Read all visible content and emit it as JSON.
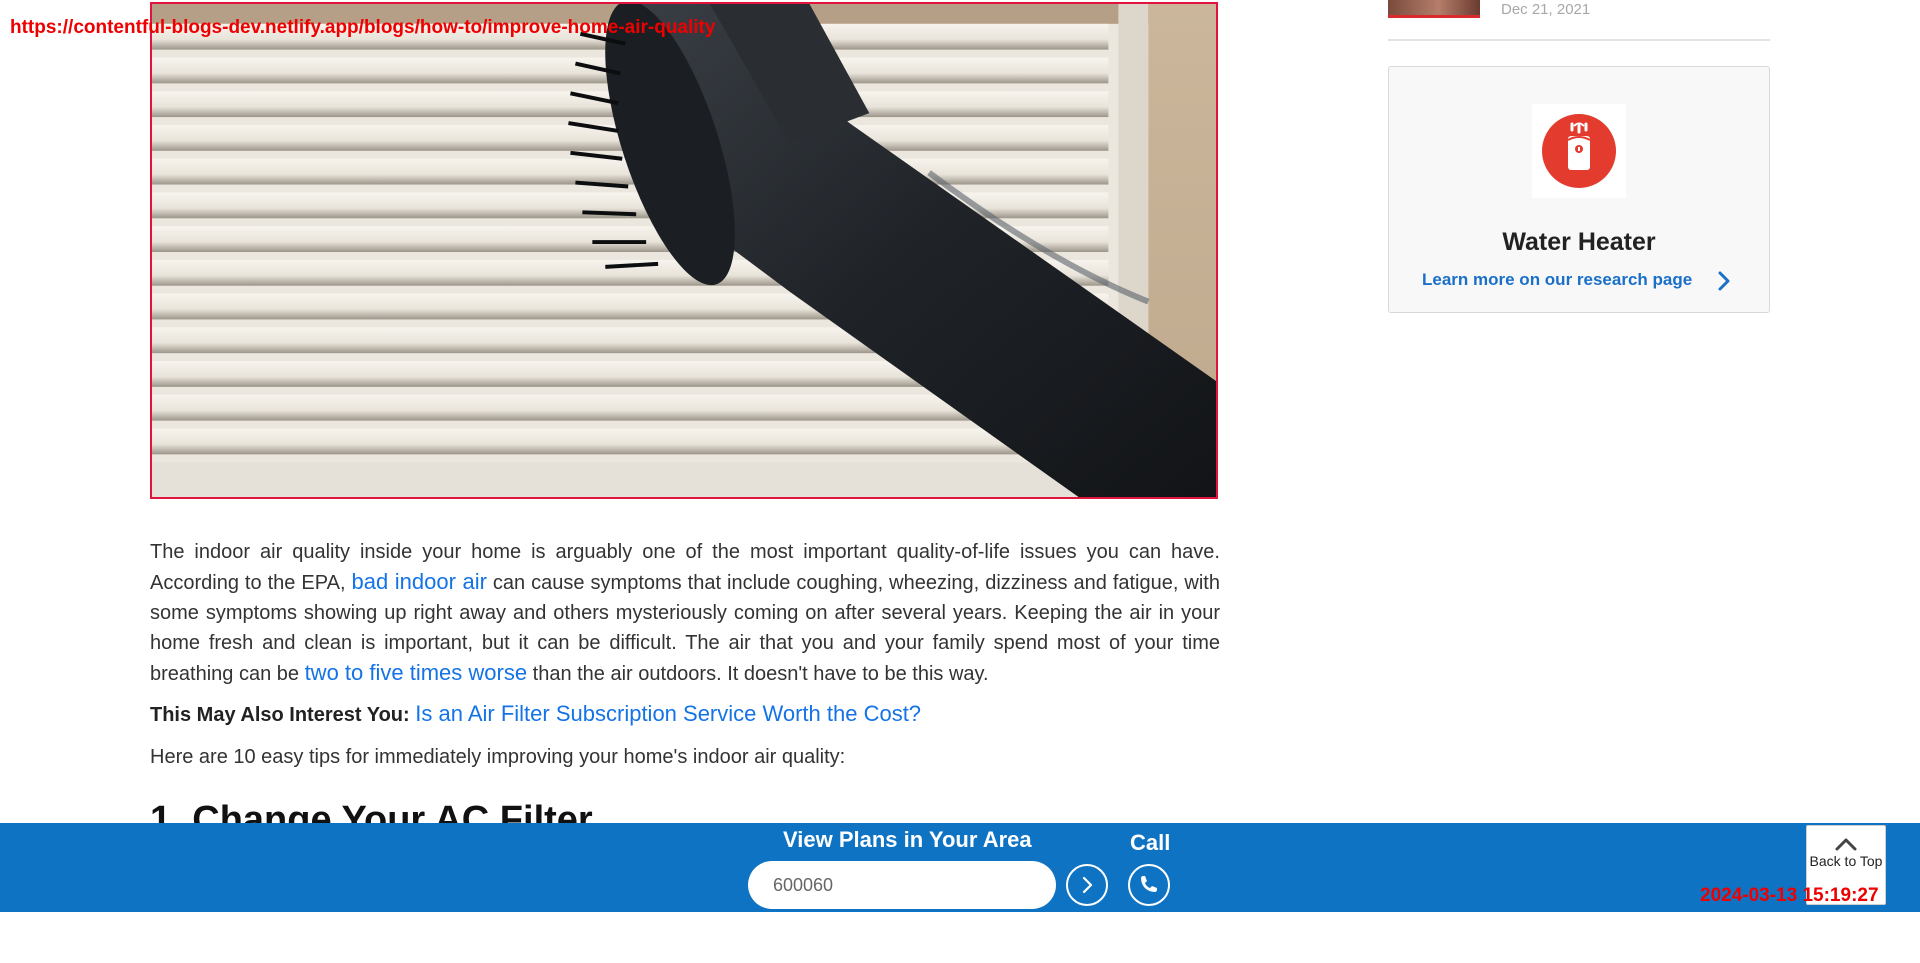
{
  "overlay": {
    "url": "https://contentful-blogs-dev.netlify.app/blogs/how-to/improve-home-air-quality",
    "timestamp": "2024-03-13 15:19:27"
  },
  "article": {
    "para1_a": "The indoor air quality inside your home is arguably one of the most important quality-of-life issues you can have. According to the EPA, ",
    "link1": "bad indoor air",
    "para1_b": " can cause symptoms that include coughing, wheezing, dizziness and fatigue, with some symptoms showing up right away and others mysteriously coming on after several years. Keeping the air in your home fresh and clean is important, but it can be difficult. The air that you and your family spend most of your time breathing can be ",
    "link2": "two to five times worse",
    "para1_c": " than the air outdoors. It doesn't have to be this way.",
    "interest_label": "This May Also Interest You:",
    "interest_link": "Is an Air Filter Subscription Service Worth the Cost?",
    "tips_intro": "Here are 10 easy tips for immediately improving your home's indoor air quality:",
    "section_heading": "1. Change Your AC Filter"
  },
  "sidebar": {
    "recent_post_date": "Dec 21, 2021",
    "card": {
      "icon": "water-heater-icon",
      "title": "Water Heater",
      "link": "Learn more on our research page"
    }
  },
  "bottom_bar": {
    "title": "View Plans in Your Area",
    "zip_value": "600060",
    "call_label": "Call",
    "back_to_top": "Back to Top"
  },
  "colors": {
    "brand_blue": "#0f73c3",
    "link_blue": "#1473e6",
    "accent_red": "#e33b2e"
  }
}
